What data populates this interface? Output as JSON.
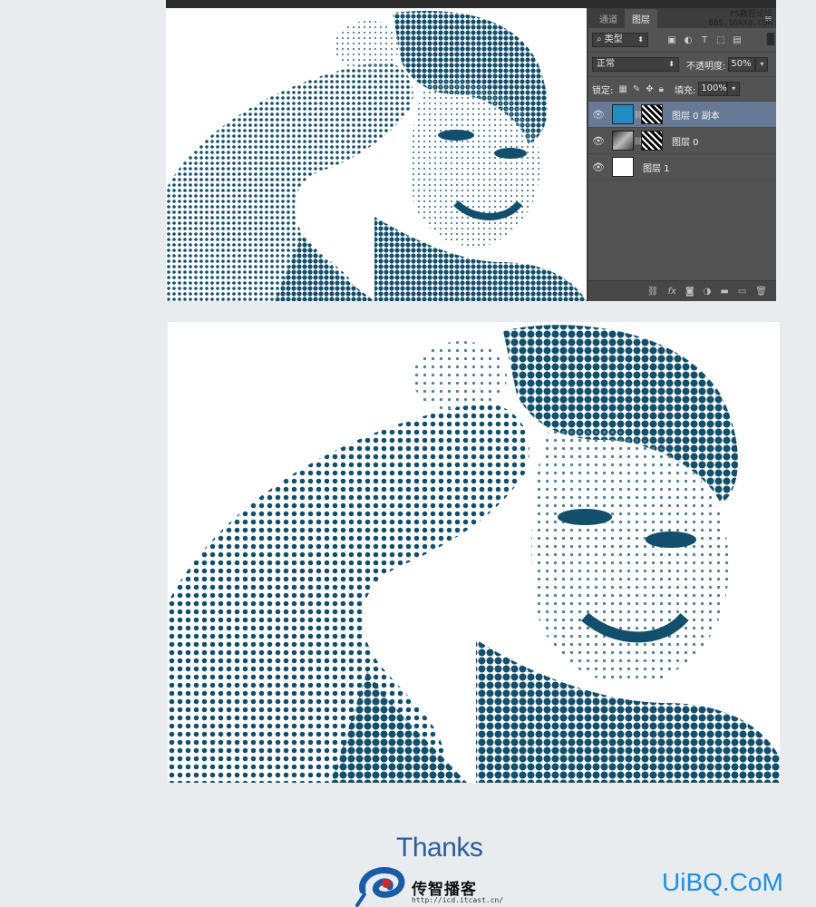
{
  "watermark_corner": {
    "line1": "PS教程论坛",
    "line2": "BBS.16XX8.COM"
  },
  "layers_panel": {
    "tabs": [
      {
        "label": "通道",
        "active": false
      },
      {
        "label": "图层",
        "active": true
      }
    ],
    "filter": {
      "kind_label": "类型"
    },
    "blend": {
      "mode": "正常",
      "opacity_label": "不透明度:",
      "opacity_value": "50%"
    },
    "lock": {
      "label": "锁定:",
      "fill_label": "填充:",
      "fill_value": "100%"
    },
    "layers": [
      {
        "name": "图层 0 副本",
        "selected": true,
        "thumb_color": "#1f8cc6"
      },
      {
        "name": "图层 0",
        "selected": false,
        "thumb_color": "#6b6b6b"
      },
      {
        "name": "图层 1",
        "selected": false,
        "thumb_color": "#ffffff"
      }
    ],
    "bottom_icons": [
      "link-icon",
      "fx-icon",
      "mask-icon",
      "adjustment-icon",
      "folder-icon",
      "new-layer-icon",
      "trash-icon"
    ]
  },
  "colors": {
    "halftone": "#124f6c",
    "halftone_light": "#5d8fa6",
    "panel": "#535353",
    "selected_layer": "#677a95",
    "thanks": "#2a5e9c",
    "uibq": "#1d8fe0",
    "brand_red": "#d6262c",
    "brand_blue": "#1b5aa6"
  },
  "footer": {
    "thanks": "Thanks",
    "brand_name": "传智播客",
    "brand_url": "http://icd.itcast.cn/",
    "site": "UiBQ.CoM"
  }
}
